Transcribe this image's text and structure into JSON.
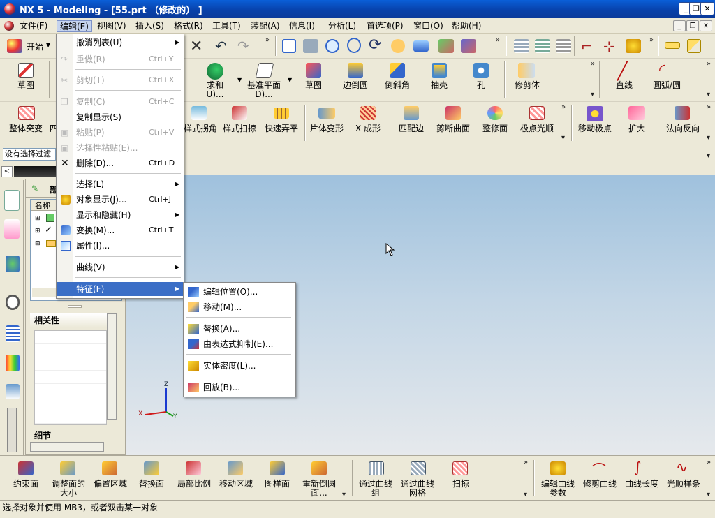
{
  "title": "NX 5 - Modeling - [55.prt （修改的） ]",
  "menus": [
    "文件(F)",
    "编辑(E)",
    "视图(V)",
    "插入(S)",
    "格式(R)",
    "工具(T)",
    "装配(A)",
    "信息(I)",
    "分析(L)",
    "首选项(P)",
    "窗口(O)",
    "帮助(H)"
  ],
  "start_label": "开始",
  "row1": {
    "sketch": "草图",
    "unite": "求和\nU)...",
    "datum": "基准平面\nD)...",
    "sketch2": "草图",
    "edge_blend": "边倒圆",
    "chamfer": "倒斜角",
    "shell": "抽壳",
    "hole": "孔",
    "trim_body": "修剪体",
    "line": "直线",
    "arc": "圆弧/圆"
  },
  "row2": {
    "global_shaping": "整体突变",
    "four": "四",
    "styled_blend": "样式拐角",
    "styled_sweep": "样式扫掠",
    "quick_trim": "快速弄平",
    "sheet_morph": "片体变形",
    "x_form": "X 成形",
    "match_edge": "匹配边",
    "trim_sheet": "剪断曲面",
    "fit_face": "整修面",
    "pole_smooth": "极点光顺",
    "move_pole": "移动极点",
    "enlarge": "扩大",
    "reverse_normal": "法向反向"
  },
  "filter": "没有选择过滤",
  "nav": {
    "head": "部",
    "col_name": "名称",
    "dependencies": "相关性",
    "details": "细节"
  },
  "edit_menu": [
    {
      "label": "撤消列表(U)",
      "key": "",
      "arrow": true,
      "dis": false
    },
    {
      "label": "重做(R)",
      "key": "Ctrl+Y",
      "dis": true
    },
    {
      "label": "剪切(T)",
      "key": "Ctrl+X",
      "dis": true
    },
    {
      "label": "复制(C)",
      "key": "Ctrl+C",
      "dis": true
    },
    {
      "label": "复制显示(S)",
      "key": "",
      "dis": false
    },
    {
      "label": "粘贴(P)",
      "key": "Ctrl+V",
      "dis": true
    },
    {
      "label": "选择性粘贴(E)...",
      "key": "",
      "dis": true
    },
    {
      "label": "删除(D)...",
      "key": "Ctrl+D",
      "dis": false
    },
    {
      "label": "选择(L)",
      "key": "",
      "arrow": true,
      "dis": false
    },
    {
      "label": "对象显示(J)...",
      "key": "Ctrl+J",
      "dis": false
    },
    {
      "label": "显示和隐藏(H)",
      "key": "",
      "arrow": true,
      "dis": false
    },
    {
      "label": "变换(M)...",
      "key": "Ctrl+T",
      "dis": false
    },
    {
      "label": "属性(I)...",
      "key": "",
      "dis": false
    },
    {
      "label": "曲线(V)",
      "key": "",
      "arrow": true,
      "dis": false
    },
    {
      "label": "特征(F)",
      "key": "",
      "arrow": true,
      "dis": false,
      "hl": true
    }
  ],
  "feature_submenu": [
    "编辑位置(O)...",
    "移动(M)...",
    "替换(A)...",
    "由表达式抑制(E)...",
    "实体密度(L)...",
    "回放(B)..."
  ],
  "bottom": {
    "offset_face": "约束面",
    "adjust": "调整面的\n大小",
    "offset_region": "偏置区域",
    "replace_face": "替换面",
    "local_scale": "局部比例",
    "move_region": "移动区域",
    "pattern_face": "图样面",
    "reblend": "重新倒圆\n面...",
    "through_curves": "通过曲线\n组",
    "through_mesh": "通过曲线\n网格",
    "sweep": "扫掠",
    "edit_curve_params": "编辑曲线\n参数",
    "trim_curve": "修剪曲线",
    "curve_length": "曲线长度",
    "smooth_spline": "光顺样条"
  },
  "axes": {
    "z": "Z",
    "x": "X",
    "y": "Y"
  },
  "status": "选择对象并使用 MB3，或者双击某一对象",
  "colors": {
    "title_bar": "#0a4fc8",
    "highlight": "#3b6ec6",
    "viewport_top": "#9fc1dd",
    "viewport_bottom": "#e6e9ec"
  }
}
